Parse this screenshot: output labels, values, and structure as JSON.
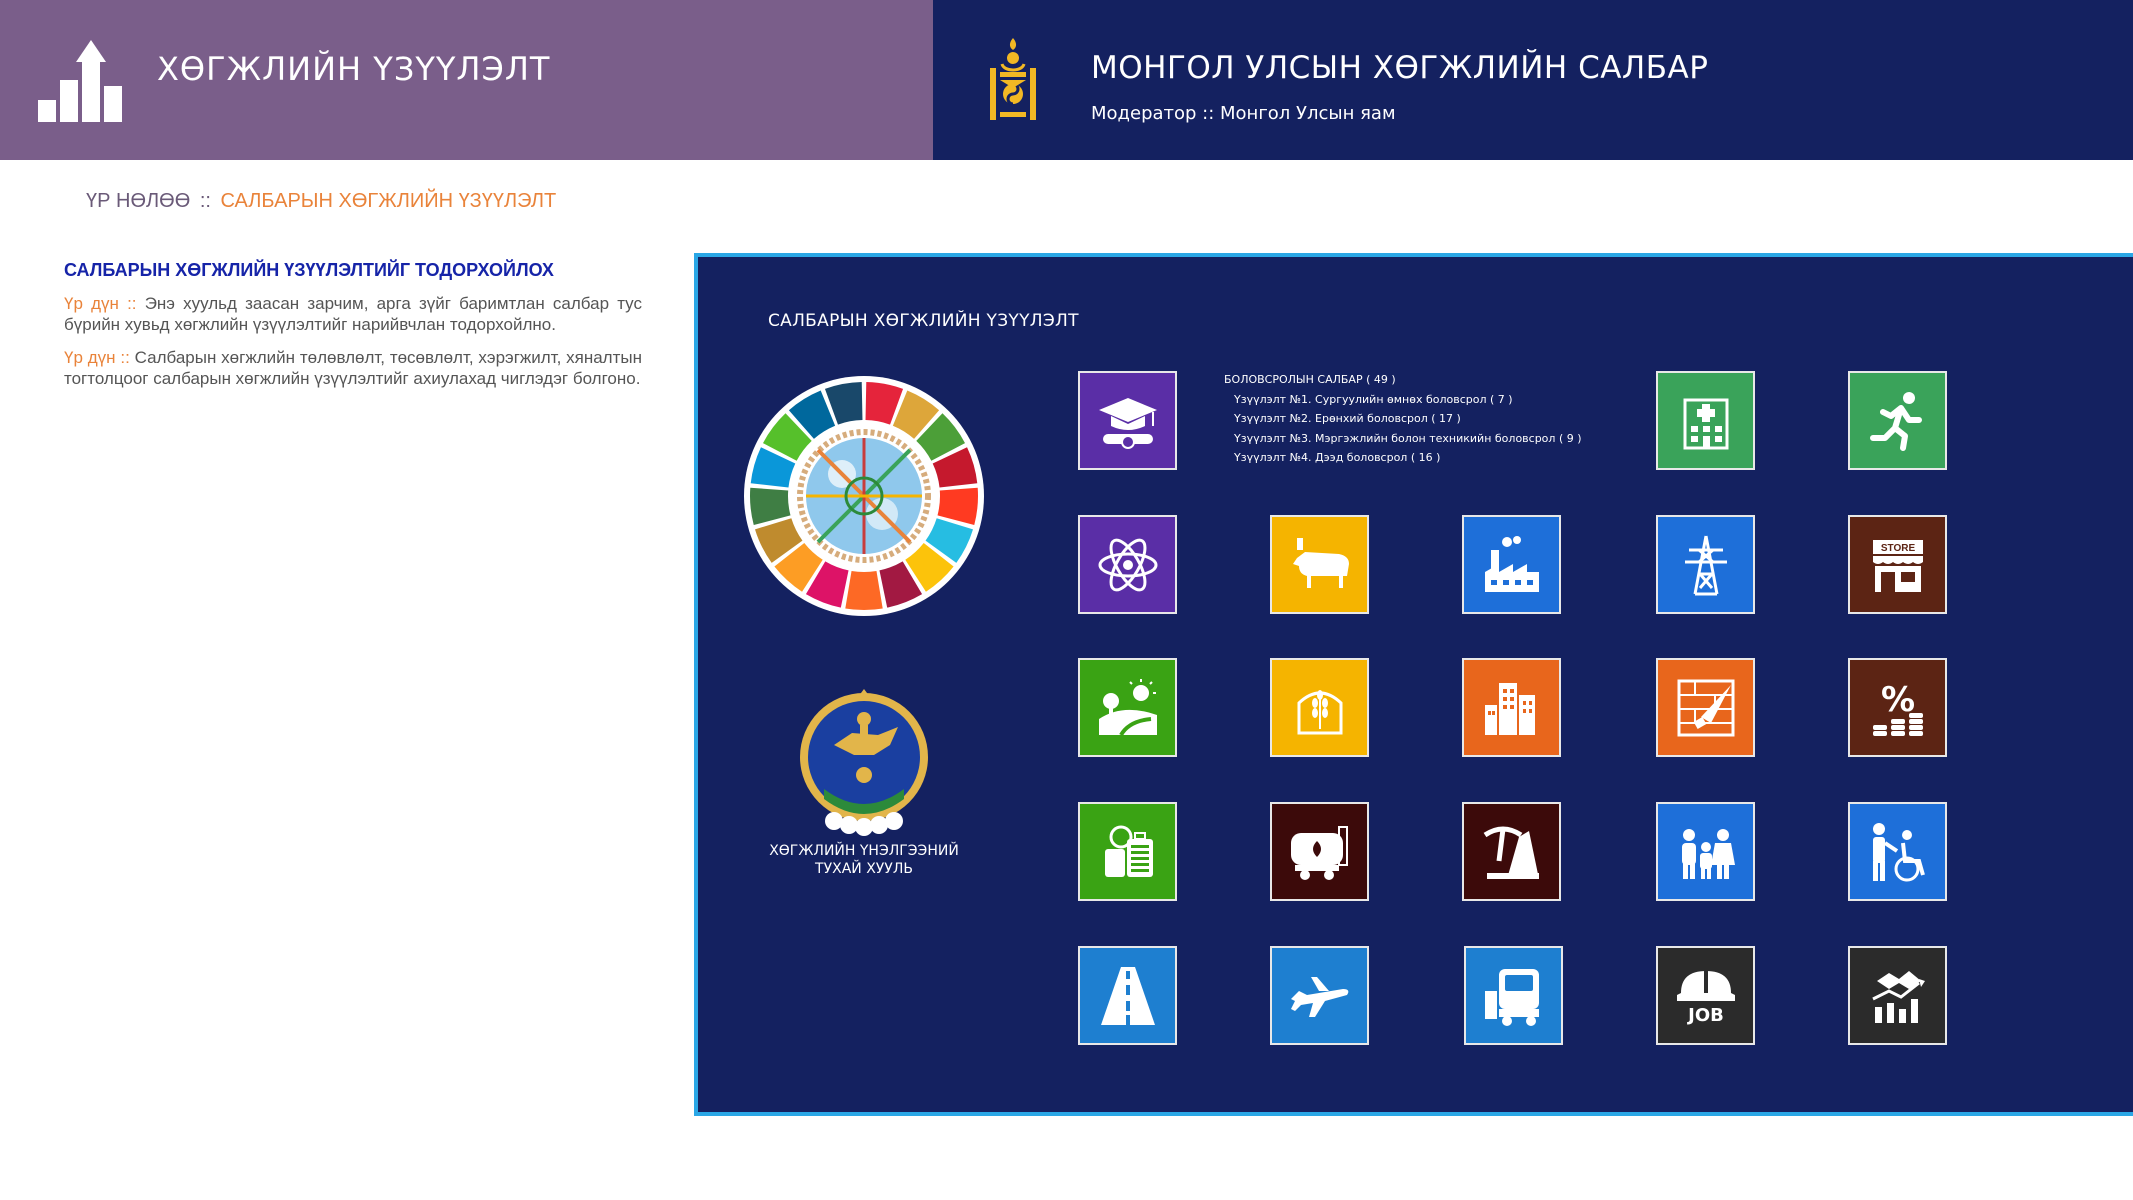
{
  "header": {
    "left_title": "ХӨГЖЛИЙН ҮЗҮҮЛЭЛТ",
    "right_title": "МОНГОЛ УЛСЫН ХӨГЖЛИЙН САЛБАР",
    "right_subtitle": "Модератор :: Монгол Улсын яам",
    "left_bg": "#7a5e8a",
    "right_bg": "#142160"
  },
  "breadcrumb": {
    "root": "ҮР НӨЛӨӨ",
    "separator": "::",
    "current": "САЛБАРЫН ХӨГЖЛИЙН ҮЗҮҮЛЭЛТ"
  },
  "left_panel": {
    "heading": "САЛБАРЫН ХӨГЖЛИЙН ҮЗҮҮЛЭЛТИЙГ ТОДОРХОЙЛОХ",
    "paragraphs": [
      {
        "label": "Үр дүн",
        "sep": "::",
        "text": "Энэ хуульд заасан зарчим, арга зүйг баримтлан салбар тус бүрийн хувьд хөгжлийн үзүүлэлтийг нарийвчлан тодорхойлно."
      },
      {
        "label": "Үр дүн",
        "sep": "::",
        "text": "Салбарын хөгжлийн төлөвлөлт, төсөвлөлт, хэрэгжилт, хяналтын тогтолцоог салбарын хөгжлийн үзүүлэлтийг ахиулахад чиглэдэг болгоно."
      }
    ]
  },
  "panel": {
    "title": "САЛБАРЫН ХӨГЖЛИЙН ҮЗҮҮЛЭЛТ",
    "emblem_caption_1": "ХӨГЖЛИЙН ҮНЭЛГЭЭНИЙ",
    "emblem_caption_2": "ТУХАЙ ХУУЛЬ",
    "info": {
      "header": "БОЛОВСРОЛЫН САЛБАР ( 49 )",
      "items": [
        "Үзүүлэлт №1. Сургуулийн өмнөх боловсрол ( 7 )",
        "Үзүүлэлт №2. Ерөнхий боловсрол ( 17 )",
        "Үзүүлэлт №3. Мэргэжлийн болон техникийн боловсрол ( 9 )",
        "Үзүүлэлт №4. Дээд боловсрол ( 16 )"
      ]
    },
    "tiles": [
      {
        "icon": "graduation-icon",
        "color": "#5a2ea6"
      },
      {
        "icon": "hospital-icon",
        "color": "#3aa35a"
      },
      {
        "icon": "runner-icon",
        "color": "#3aa35a"
      },
      {
        "icon": "atom-icon",
        "color": "#5a2ea6"
      },
      {
        "icon": "cow-icon",
        "color": "#f5b400"
      },
      {
        "icon": "factory-icon",
        "color": "#1e6fd9"
      },
      {
        "icon": "power-tower-icon",
        "color": "#1e6fd9"
      },
      {
        "icon": "store-icon",
        "color": "#5c2414"
      },
      {
        "icon": "landscape-icon",
        "color": "#3aa314"
      },
      {
        "icon": "wheat-icon",
        "color": "#f5b400"
      },
      {
        "icon": "buildings-icon",
        "color": "#e8661c"
      },
      {
        "icon": "construction-icon",
        "color": "#e8661c"
      },
      {
        "icon": "percent-icon",
        "color": "#5c2414"
      },
      {
        "icon": "tourism-icon",
        "color": "#3aa314"
      },
      {
        "icon": "fuel-tank-icon",
        "color": "#3c0a0a"
      },
      {
        "icon": "mining-icon",
        "color": "#3c0a0a"
      },
      {
        "icon": "family-icon",
        "color": "#1e6fd9"
      },
      {
        "icon": "disability-care-icon",
        "color": "#1e6fd9"
      },
      {
        "icon": "road-icon",
        "color": "#1e7fd0"
      },
      {
        "icon": "airplane-icon",
        "color": "#1e7fd0"
      },
      {
        "icon": "truck-icon",
        "color": "#1e7fd0"
      },
      {
        "icon": "job-helmet-icon",
        "color": "#2b2b2b"
      },
      {
        "icon": "business-chart-icon",
        "color": "#2b2b2b"
      }
    ],
    "tile_store_label": "STORE",
    "tile_percent_label": "%",
    "tile_job_label": "JOB"
  }
}
